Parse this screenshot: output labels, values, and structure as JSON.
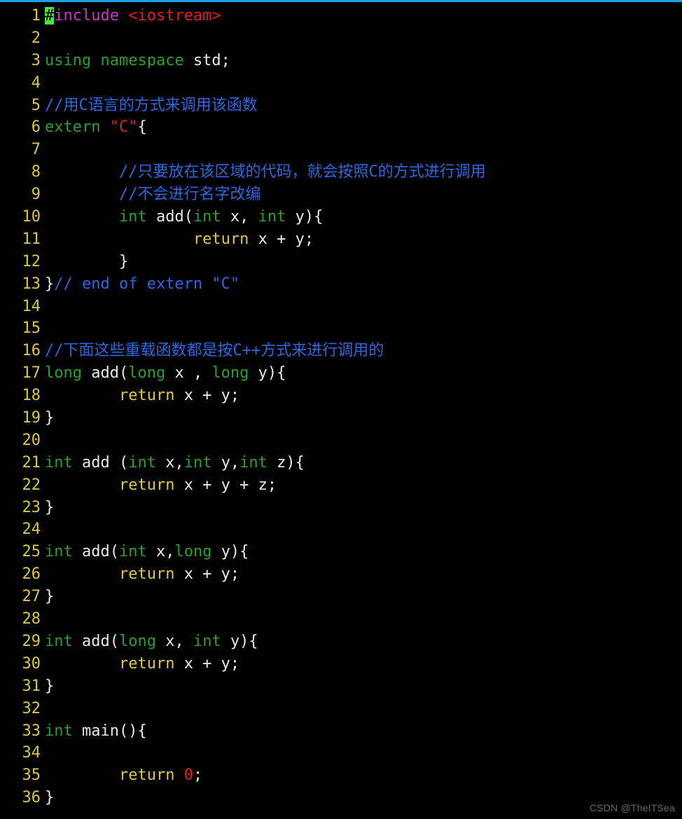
{
  "watermark": "CSDN @TheITSea",
  "lines": [
    {
      "n": "1",
      "tokens": [
        {
          "c": "cursor",
          "t": "#"
        },
        {
          "c": "c-purple",
          "t": "include "
        },
        {
          "c": "c-red",
          "t": "<iostream>"
        }
      ]
    },
    {
      "n": "2",
      "tokens": [
        {
          "c": "c-white",
          "t": ""
        }
      ]
    },
    {
      "n": "3",
      "tokens": [
        {
          "c": "c-green",
          "t": "using "
        },
        {
          "c": "c-green",
          "t": "namespace "
        },
        {
          "c": "c-white",
          "t": "std;"
        }
      ]
    },
    {
      "n": "4",
      "tokens": [
        {
          "c": "c-white",
          "t": ""
        }
      ]
    },
    {
      "n": "5",
      "tokens": [
        {
          "c": "c-blue",
          "t": "//用C语言的方式来调用该函数"
        }
      ]
    },
    {
      "n": "6",
      "tokens": [
        {
          "c": "c-green",
          "t": "extern "
        },
        {
          "c": "c-red",
          "t": "\"C\""
        },
        {
          "c": "c-white",
          "t": "{"
        }
      ]
    },
    {
      "n": "7",
      "tokens": [
        {
          "c": "c-white",
          "t": ""
        }
      ]
    },
    {
      "n": "8",
      "tokens": [
        {
          "c": "c-white",
          "t": "        "
        },
        {
          "c": "c-blue",
          "t": "//只要放在该区域的代码，就会按照C的方式进行调用"
        }
      ]
    },
    {
      "n": "9",
      "tokens": [
        {
          "c": "c-white",
          "t": "        "
        },
        {
          "c": "c-blue",
          "t": "//不会进行名字改编"
        }
      ]
    },
    {
      "n": "10",
      "tokens": [
        {
          "c": "c-white",
          "t": "        "
        },
        {
          "c": "c-green",
          "t": "int "
        },
        {
          "c": "c-white",
          "t": "add("
        },
        {
          "c": "c-green",
          "t": "int "
        },
        {
          "c": "c-white",
          "t": "x, "
        },
        {
          "c": "c-green",
          "t": "int "
        },
        {
          "c": "c-white",
          "t": "y){"
        }
      ]
    },
    {
      "n": "11",
      "tokens": [
        {
          "c": "c-white",
          "t": "                "
        },
        {
          "c": "c-yellow",
          "t": "return "
        },
        {
          "c": "c-white",
          "t": "x + y;"
        }
      ]
    },
    {
      "n": "12",
      "tokens": [
        {
          "c": "c-white",
          "t": "        }"
        }
      ]
    },
    {
      "n": "13",
      "tokens": [
        {
          "c": "c-white",
          "t": "}"
        },
        {
          "c": "c-blue",
          "t": "// end of extern \"C\""
        }
      ]
    },
    {
      "n": "14",
      "tokens": [
        {
          "c": "c-white",
          "t": ""
        }
      ]
    },
    {
      "n": "15",
      "tokens": [
        {
          "c": "c-white",
          "t": ""
        }
      ]
    },
    {
      "n": "16",
      "tokens": [
        {
          "c": "c-blue",
          "t": "//下面这些重载函数都是按C++方式来进行调用的"
        }
      ]
    },
    {
      "n": "17",
      "tokens": [
        {
          "c": "c-green",
          "t": "long "
        },
        {
          "c": "c-white",
          "t": "add("
        },
        {
          "c": "c-green",
          "t": "long "
        },
        {
          "c": "c-white",
          "t": "x , "
        },
        {
          "c": "c-green",
          "t": "long "
        },
        {
          "c": "c-white",
          "t": "y){"
        }
      ]
    },
    {
      "n": "18",
      "tokens": [
        {
          "c": "c-white",
          "t": "        "
        },
        {
          "c": "c-yellow",
          "t": "return "
        },
        {
          "c": "c-white",
          "t": "x + y;"
        }
      ]
    },
    {
      "n": "19",
      "tokens": [
        {
          "c": "c-white",
          "t": "}"
        }
      ]
    },
    {
      "n": "20",
      "tokens": [
        {
          "c": "c-white",
          "t": ""
        }
      ]
    },
    {
      "n": "21",
      "tokens": [
        {
          "c": "c-green",
          "t": "int "
        },
        {
          "c": "c-white",
          "t": "add ("
        },
        {
          "c": "c-green",
          "t": "int "
        },
        {
          "c": "c-white",
          "t": "x,"
        },
        {
          "c": "c-green",
          "t": "int "
        },
        {
          "c": "c-white",
          "t": "y,"
        },
        {
          "c": "c-green",
          "t": "int "
        },
        {
          "c": "c-white",
          "t": "z){"
        }
      ]
    },
    {
      "n": "22",
      "tokens": [
        {
          "c": "c-white",
          "t": "        "
        },
        {
          "c": "c-yellow",
          "t": "return "
        },
        {
          "c": "c-white",
          "t": "x + y + z;"
        }
      ]
    },
    {
      "n": "23",
      "tokens": [
        {
          "c": "c-white",
          "t": "}"
        }
      ]
    },
    {
      "n": "24",
      "tokens": [
        {
          "c": "c-white",
          "t": ""
        }
      ]
    },
    {
      "n": "25",
      "tokens": [
        {
          "c": "c-green",
          "t": "int "
        },
        {
          "c": "c-white",
          "t": "add("
        },
        {
          "c": "c-green",
          "t": "int "
        },
        {
          "c": "c-white",
          "t": "x,"
        },
        {
          "c": "c-green",
          "t": "long "
        },
        {
          "c": "c-white",
          "t": "y){"
        }
      ]
    },
    {
      "n": "26",
      "tokens": [
        {
          "c": "c-white",
          "t": "        "
        },
        {
          "c": "c-yellow",
          "t": "return "
        },
        {
          "c": "c-white",
          "t": "x + y;"
        }
      ]
    },
    {
      "n": "27",
      "tokens": [
        {
          "c": "c-white",
          "t": "}"
        }
      ]
    },
    {
      "n": "28",
      "tokens": [
        {
          "c": "c-white",
          "t": ""
        }
      ]
    },
    {
      "n": "29",
      "tokens": [
        {
          "c": "c-green",
          "t": "int "
        },
        {
          "c": "c-white",
          "t": "add("
        },
        {
          "c": "c-green",
          "t": "long "
        },
        {
          "c": "c-white",
          "t": "x, "
        },
        {
          "c": "c-green",
          "t": "int "
        },
        {
          "c": "c-white",
          "t": "y){"
        }
      ]
    },
    {
      "n": "30",
      "tokens": [
        {
          "c": "c-white",
          "t": "        "
        },
        {
          "c": "c-yellow",
          "t": "return "
        },
        {
          "c": "c-white",
          "t": "x + y;"
        }
      ]
    },
    {
      "n": "31",
      "tokens": [
        {
          "c": "c-white",
          "t": "}"
        }
      ]
    },
    {
      "n": "32",
      "tokens": [
        {
          "c": "c-white",
          "t": ""
        }
      ]
    },
    {
      "n": "33",
      "tokens": [
        {
          "c": "c-green",
          "t": "int "
        },
        {
          "c": "c-white",
          "t": "main(){"
        }
      ]
    },
    {
      "n": "34",
      "tokens": [
        {
          "c": "c-white",
          "t": ""
        }
      ]
    },
    {
      "n": "35",
      "tokens": [
        {
          "c": "c-white",
          "t": "        "
        },
        {
          "c": "c-yellow",
          "t": "return "
        },
        {
          "c": "c-red",
          "t": "0"
        },
        {
          "c": "c-white",
          "t": ";"
        }
      ]
    },
    {
      "n": "36",
      "tokens": [
        {
          "c": "c-white",
          "t": "}"
        }
      ]
    }
  ]
}
